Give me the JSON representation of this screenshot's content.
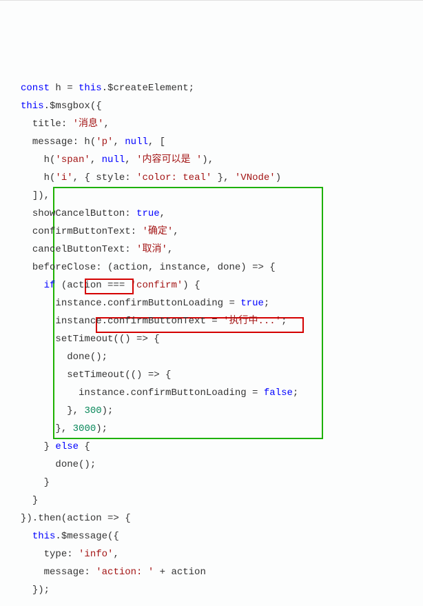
{
  "lines": [
    {
      "indent": 0,
      "tokens": [
        {
          "t": "const",
          "c": "kw"
        },
        {
          "t": " h = ",
          "c": ""
        },
        {
          "t": "this",
          "c": "th"
        },
        {
          "t": ".$createElement;",
          "c": ""
        }
      ]
    },
    {
      "indent": 0,
      "tokens": [
        {
          "t": "this",
          "c": "th"
        },
        {
          "t": ".$msgbox({",
          "c": ""
        }
      ]
    },
    {
      "indent": 1,
      "tokens": [
        {
          "t": "title: ",
          "c": ""
        },
        {
          "t": "'消息'",
          "c": "str"
        },
        {
          "t": ",",
          "c": ""
        }
      ]
    },
    {
      "indent": 1,
      "tokens": [
        {
          "t": "message: h(",
          "c": ""
        },
        {
          "t": "'p'",
          "c": "str"
        },
        {
          "t": ", ",
          "c": ""
        },
        {
          "t": "null",
          "c": "kw"
        },
        {
          "t": ", [",
          "c": ""
        }
      ]
    },
    {
      "indent": 2,
      "tokens": [
        {
          "t": "h(",
          "c": ""
        },
        {
          "t": "'span'",
          "c": "str"
        },
        {
          "t": ", ",
          "c": ""
        },
        {
          "t": "null",
          "c": "kw"
        },
        {
          "t": ", ",
          "c": ""
        },
        {
          "t": "'内容可以是 '",
          "c": "str"
        },
        {
          "t": "),",
          "c": ""
        }
      ]
    },
    {
      "indent": 2,
      "tokens": [
        {
          "t": "h(",
          "c": ""
        },
        {
          "t": "'i'",
          "c": "str"
        },
        {
          "t": ", { style: ",
          "c": ""
        },
        {
          "t": "'color: teal'",
          "c": "str"
        },
        {
          "t": " }, ",
          "c": ""
        },
        {
          "t": "'VNode'",
          "c": "str"
        },
        {
          "t": ")",
          "c": ""
        }
      ]
    },
    {
      "indent": 1,
      "tokens": [
        {
          "t": "]),",
          "c": ""
        }
      ]
    },
    {
      "indent": 1,
      "tokens": [
        {
          "t": "showCancelButton: ",
          "c": ""
        },
        {
          "t": "true",
          "c": "bool"
        },
        {
          "t": ",",
          "c": ""
        }
      ]
    },
    {
      "indent": 1,
      "tokens": [
        {
          "t": "confirmButtonText: ",
          "c": ""
        },
        {
          "t": "'确定'",
          "c": "str"
        },
        {
          "t": ",",
          "c": ""
        }
      ]
    },
    {
      "indent": 1,
      "tokens": [
        {
          "t": "cancelButtonText: ",
          "c": ""
        },
        {
          "t": "'取消'",
          "c": "str"
        },
        {
          "t": ",",
          "c": ""
        }
      ]
    },
    {
      "indent": 1,
      "tokens": [
        {
          "t": "beforeClose: (action, instance, done) => {",
          "c": ""
        }
      ]
    },
    {
      "indent": 2,
      "tokens": [
        {
          "t": "if",
          "c": "kw"
        },
        {
          "t": " (action === ",
          "c": ""
        },
        {
          "t": "'confirm'",
          "c": "str"
        },
        {
          "t": ") {",
          "c": ""
        }
      ]
    },
    {
      "indent": 3,
      "tokens": [
        {
          "t": "instance.confirmButtonLoading = ",
          "c": ""
        },
        {
          "t": "true",
          "c": "bool"
        },
        {
          "t": ";",
          "c": ""
        }
      ]
    },
    {
      "indent": 3,
      "tokens": [
        {
          "t": "instance.confirmButtonText = ",
          "c": ""
        },
        {
          "t": "'执行中...'",
          "c": "str"
        },
        {
          "t": ";",
          "c": ""
        }
      ]
    },
    {
      "indent": 3,
      "tokens": [
        {
          "t": "setTimeout(() => {",
          "c": ""
        }
      ]
    },
    {
      "indent": 4,
      "tokens": [
        {
          "t": "done();",
          "c": ""
        }
      ]
    },
    {
      "indent": 4,
      "tokens": [
        {
          "t": "setTimeout(() => {",
          "c": ""
        }
      ]
    },
    {
      "indent": 5,
      "tokens": [
        {
          "t": "instance.confirmButtonLoading = ",
          "c": ""
        },
        {
          "t": "false",
          "c": "bool"
        },
        {
          "t": ";",
          "c": ""
        }
      ]
    },
    {
      "indent": 4,
      "tokens": [
        {
          "t": "}, ",
          "c": ""
        },
        {
          "t": "300",
          "c": "num"
        },
        {
          "t": ");",
          "c": ""
        }
      ]
    },
    {
      "indent": 3,
      "tokens": [
        {
          "t": "}, ",
          "c": ""
        },
        {
          "t": "3000",
          "c": "num"
        },
        {
          "t": ");",
          "c": ""
        }
      ]
    },
    {
      "indent": 2,
      "tokens": [
        {
          "t": "} ",
          "c": ""
        },
        {
          "t": "else",
          "c": "kw"
        },
        {
          "t": " {",
          "c": ""
        }
      ]
    },
    {
      "indent": 3,
      "tokens": [
        {
          "t": "done();",
          "c": ""
        }
      ]
    },
    {
      "indent": 2,
      "tokens": [
        {
          "t": "}",
          "c": ""
        }
      ]
    },
    {
      "indent": 1,
      "tokens": [
        {
          "t": "}",
          "c": ""
        }
      ]
    },
    {
      "indent": 0,
      "tokens": [
        {
          "t": "}).then(action => {",
          "c": ""
        }
      ]
    },
    {
      "indent": 1,
      "tokens": [
        {
          "t": "this",
          "c": "th"
        },
        {
          "t": ".$message({",
          "c": ""
        }
      ]
    },
    {
      "indent": 2,
      "tokens": [
        {
          "t": "type: ",
          "c": ""
        },
        {
          "t": "'info'",
          "c": "str"
        },
        {
          "t": ",",
          "c": ""
        }
      ]
    },
    {
      "indent": 2,
      "tokens": [
        {
          "t": "message: ",
          "c": ""
        },
        {
          "t": "'action: '",
          "c": "str"
        },
        {
          "t": " + action",
          "c": ""
        }
      ]
    },
    {
      "indent": 1,
      "tokens": [
        {
          "t": "});",
          "c": ""
        }
      ]
    }
  ],
  "highlightBoxes": {
    "green": {
      "desc": "beforeClose function block"
    },
    "red1": {
      "desc": "done() call"
    },
    "red2": {
      "desc": "instance.confirmButtonLoading = false"
    }
  }
}
